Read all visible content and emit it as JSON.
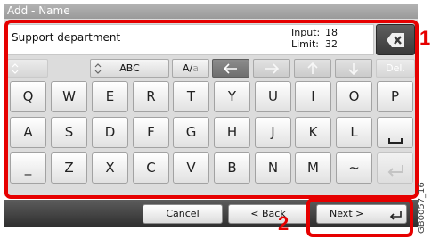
{
  "window": {
    "title": "Add - Name"
  },
  "input": {
    "value": "Support department",
    "input_label": "Input:",
    "input_value": "18",
    "limit_label": "Limit:",
    "limit_value": "32"
  },
  "controls": {
    "abc_label": "ABC",
    "case_label_upper": "A/",
    "case_label_lower": "a",
    "del_label": "Del."
  },
  "keys": {
    "row1": [
      "Q",
      "W",
      "E",
      "R",
      "T",
      "Y",
      "U",
      "I",
      "O",
      "P"
    ],
    "row2": [
      "A",
      "S",
      "D",
      "F",
      "G",
      "H",
      "J",
      "K",
      "L"
    ],
    "row3": [
      "_",
      "Z",
      "X",
      "C",
      "V",
      "B",
      "N",
      "M",
      "~"
    ]
  },
  "bottom": {
    "cancel_label": "Cancel",
    "back_label": "< Back",
    "next_label": "Next >"
  },
  "callouts": {
    "one": "1",
    "two": "2"
  },
  "figure_code": "GB0057_16",
  "colors": {
    "highlight": "#e60000",
    "panel": "#dcdcdc",
    "bottom_bar": "#3c3c3c"
  },
  "icons": [
    "backspace-icon",
    "double-caret-icon",
    "left-arrow-icon",
    "right-arrow-icon",
    "up-arrow-icon",
    "down-arrow-icon",
    "space-icon",
    "enter-icon"
  ]
}
